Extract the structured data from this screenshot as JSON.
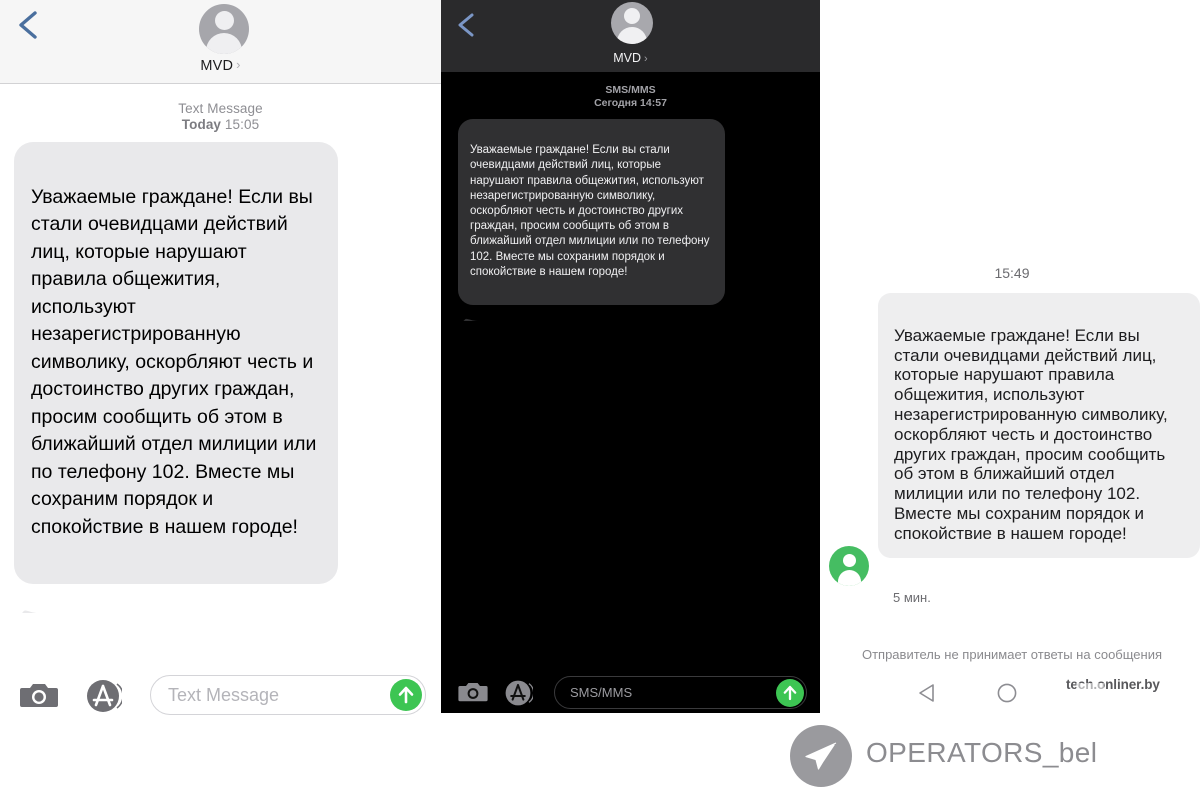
{
  "panel_ios_light": {
    "contact_name": "MVD",
    "back_icon": "back-chevron-icon",
    "avatar_icon": "contact-avatar-icon",
    "disclosure_icon": "chevron-right-icon",
    "meta_type": "Text Message",
    "meta_day": "Today",
    "meta_time": "15:05",
    "message_text": "Уважаемые граждане! Если вы стали очевидцами действий лиц, которые нарушают правила общежития, используют незарегистрированную символику, оскорбляют честь и достоинство других граждан, просим сообщить об этом в ближайший отдел милиции или по телефону 102. Вместе мы сохраним порядок и спокойствие в нашем городе!",
    "toolbar": {
      "camera_icon": "camera-icon",
      "app_store_icon": "app-store-icon",
      "input_placeholder": "Text Message",
      "input_value": "",
      "send_icon": "send-arrow-up-icon"
    },
    "colors": {
      "bubble": "#e9e9eb",
      "send": "#3dc553",
      "navbar": "#f6f6f6"
    }
  },
  "panel_ios_dark": {
    "contact_name": "MVD",
    "back_icon": "back-chevron-icon",
    "avatar_icon": "contact-avatar-icon",
    "disclosure_icon": "chevron-right-icon",
    "meta_type": "SMS/MMS",
    "meta_datetime": "Сегодня 14:57",
    "message_text": "Уважаемые граждане! Если вы стали очевидцами действий лиц, которые нарушают правила общежития, используют незарегистрированную символику, оскорбляют честь и достоинство других граждан, просим сообщить об этом в ближайший отдел милиции или по телефону 102. Вместе мы сохраним порядок и спокойствие в нашем городе!",
    "toolbar": {
      "camera_icon": "camera-icon",
      "app_store_icon": "app-store-icon",
      "input_placeholder": "SMS/MMS",
      "input_value": "",
      "send_icon": "send-arrow-up-icon"
    },
    "colors": {
      "bubble": "#303032",
      "background": "#000000",
      "navbar": "#2a2a2c",
      "send": "#3dc553"
    }
  },
  "panel_android": {
    "timestamp": "15:49",
    "avatar_icon": "contact-avatar-icon",
    "message_text": "Уважаемые граждане! Если вы стали очевидцами действий лиц, которые нарушают правила общежития, используют незарегистрированную символику, оскорбляют честь и достоинство других граждан, просим сообщить об этом в ближайший отдел милиции или по телефону 102. Вместе мы сохраним порядок и спокойствие в нашем городе!",
    "relative_time": "5 мин.",
    "notice": "Отправитель не принимает ответы на сообщения",
    "nav": {
      "back_icon": "nav-back-triangle-icon",
      "home_icon": "nav-home-circle-icon"
    },
    "watermark": "tech.onliner.by",
    "colors": {
      "bubble": "#eeeeef",
      "avatar": "#45bd62"
    }
  },
  "brand_badge": {
    "icon": "telegram-paper-plane-icon",
    "label": "OPERATORS_bel"
  }
}
